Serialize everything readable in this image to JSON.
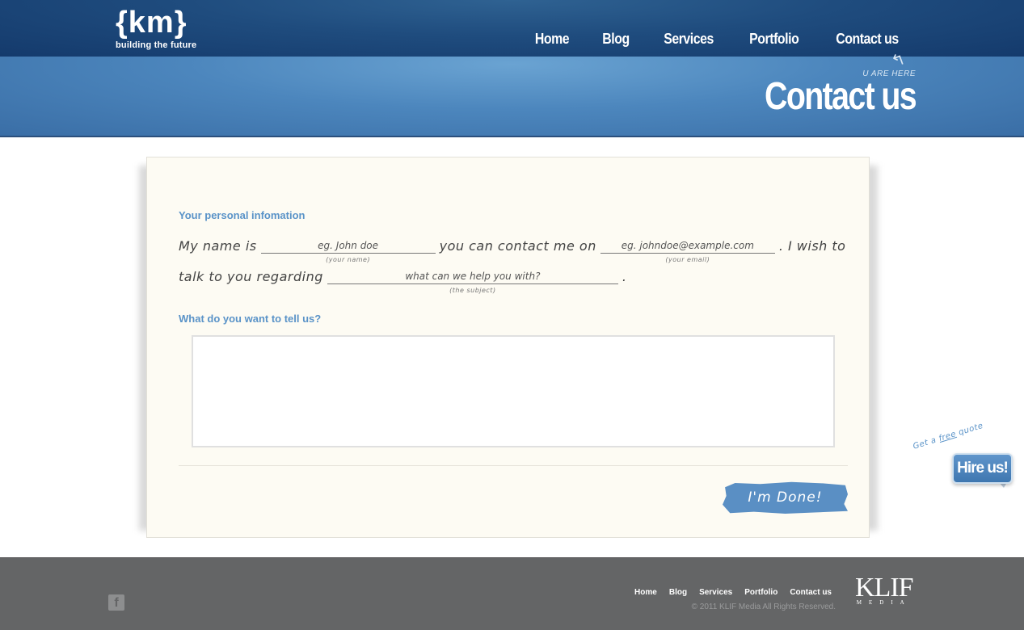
{
  "header": {
    "logo_mark": "{km}",
    "logo_tagline": "building the future",
    "nav": [
      "Home",
      "Blog",
      "Services",
      "Portfolio",
      "Contact us"
    ]
  },
  "banner": {
    "you_are_here": "U ARE HERE",
    "title": "Contact us"
  },
  "form": {
    "personal_title": "Your personal infomation",
    "sentence_1": "My name is",
    "sentence_2": "you can contact me on",
    "sentence_3": ". I wish to",
    "sentence_4": "talk to you regarding",
    "sentence_5": ".",
    "name_placeholder": "eg. John doe",
    "name_hint": "(your name)",
    "email_placeholder": "eg. johndoe@example.com",
    "email_hint": "(your email)",
    "subject_placeholder": "what can we help you with?",
    "subject_hint": "(the subject)",
    "message_title": "What do you want to tell us?",
    "message_value": "",
    "submit_label": "I'm Done!"
  },
  "hire": {
    "quote_prefix": "Get a ",
    "quote_free": "free",
    "quote_suffix": " quote",
    "label": "Hire us!"
  },
  "footer": {
    "facebook_icon": "f",
    "nav": [
      "Home",
      "Blog",
      "Services",
      "Portfolio",
      "Contact us"
    ],
    "copyright": "© 2011 KLIF Media All Rights Reserved.",
    "brand": "KLIF",
    "brand_sub": "MEDIA"
  },
  "colors": {
    "header_dark": "#143a6c",
    "banner_light": "#6aa3d2",
    "accent_blue": "#5a93c8",
    "paper": "#fdfbf3",
    "footer": "#646566"
  }
}
